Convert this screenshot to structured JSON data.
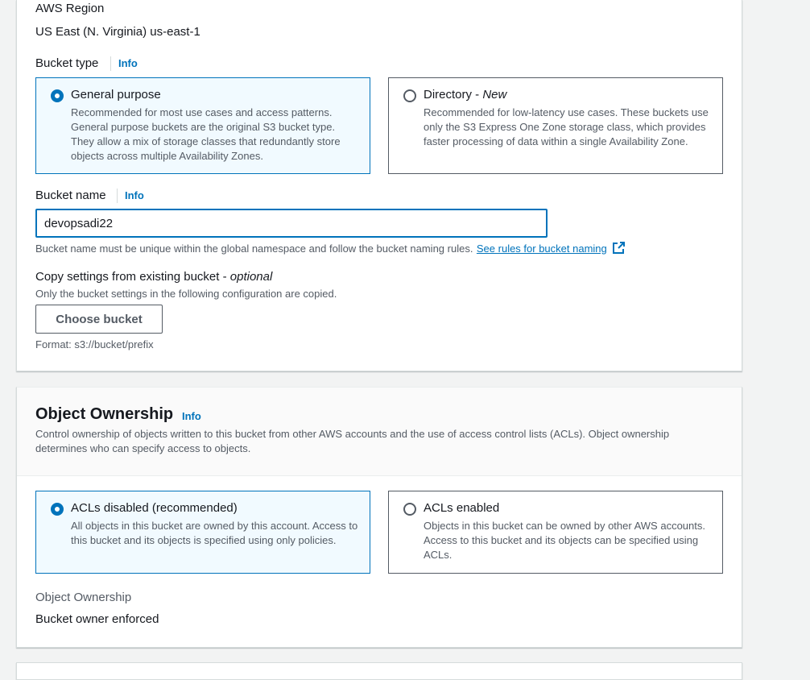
{
  "general": {
    "region_label": "AWS Region",
    "region_value": "US East (N. Virginia) us-east-1",
    "bucket_type_label": "Bucket type",
    "info": "Info"
  },
  "bucket_type": {
    "options": [
      {
        "title": "General purpose",
        "tag": "",
        "description": "Recommended for most use cases and access patterns. General purpose buckets are the original S3 bucket type. They allow a mix of storage classes that redundantly store objects across multiple Availability Zones.",
        "selected": true
      },
      {
        "title": "Directory - ",
        "tag": "New",
        "description": "Recommended for low-latency use cases. These buckets use only the S3 Express One Zone storage class, which provides faster processing of data within a single Availability Zone.",
        "selected": false
      }
    ]
  },
  "bucket_name": {
    "label": "Bucket name",
    "info": "Info",
    "value": "devopsadi22",
    "hint": "Bucket name must be unique within the global namespace and follow the bucket naming rules.",
    "rules_link": "See rules for bucket naming"
  },
  "copy_settings": {
    "label": "Copy settings from existing bucket - ",
    "optional": "optional",
    "description": "Only the bucket settings in the following configuration are copied.",
    "button": "Choose bucket",
    "format_hint": "Format: s3://bucket/prefix"
  },
  "object_ownership": {
    "title": "Object Ownership",
    "info": "Info",
    "description": "Control ownership of objects written to this bucket from other AWS accounts and the use of access control lists (ACLs). Object ownership determines who can specify access to objects.",
    "options": [
      {
        "title": "ACLs disabled (recommended)",
        "description": "All objects in this bucket are owned by this account. Access to this bucket and its objects is specified using only policies.",
        "selected": true
      },
      {
        "title": "ACLs enabled",
        "description": "Objects in this bucket can be owned by other AWS accounts. Access to this bucket and its objects can be specified using ACLs.",
        "selected": false
      }
    ],
    "summary_label": "Object Ownership",
    "summary_value": "Bucket owner enforced"
  },
  "colors": {
    "accent": "#0073bb",
    "selected_bg": "#f1faff",
    "text": "#16191f",
    "secondary_text": "#545b64"
  },
  "icons": {
    "external_link": "external-link-icon"
  }
}
